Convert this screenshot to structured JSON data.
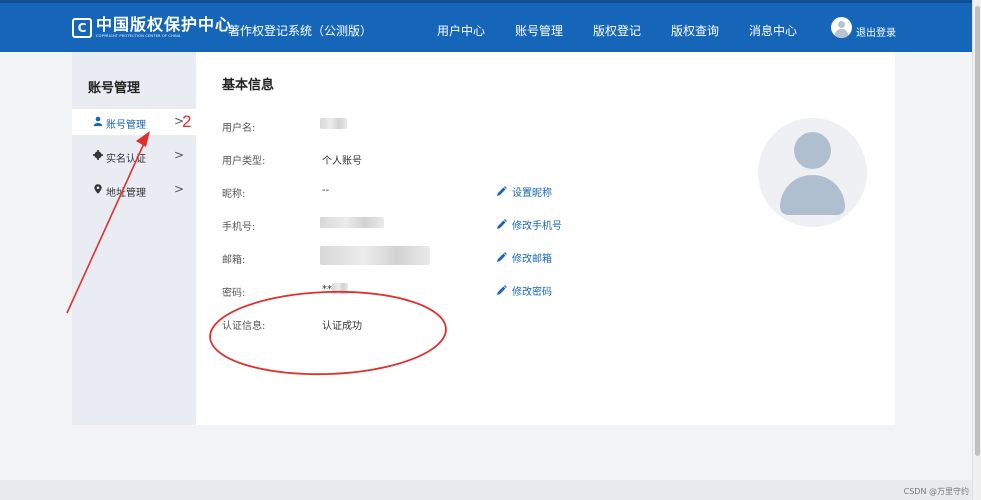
{
  "header": {
    "logo_mark": "C",
    "logo_cn": "中国版权保护中心",
    "logo_en": "COPYRIGHT PROTECTION CENTER OF CHINA",
    "system_title": "著作权登记系统（公测版）",
    "nav": [
      "用户中心",
      "账号管理",
      "版权登记",
      "版权查询",
      "消息中心"
    ],
    "logout": "退出登录"
  },
  "sidebar": {
    "title": "账号管理",
    "items": [
      {
        "label": "账号管理",
        "icon": "user-icon",
        "active": true
      },
      {
        "label": "实名认证",
        "icon": "gear-icon",
        "active": false
      },
      {
        "label": "地址管理",
        "icon": "location-pin-icon",
        "active": false
      }
    ]
  },
  "main": {
    "title": "基本信息",
    "rows": [
      {
        "label": "用户名:",
        "value": ""
      },
      {
        "label": "用户类型:",
        "value": "个人账号"
      },
      {
        "label": "昵称:",
        "value": "--",
        "action": "设置昵称"
      },
      {
        "label": "手机号:",
        "value": "",
        "action": "修改手机号"
      },
      {
        "label": "邮箱:",
        "value": "",
        "action": "修改邮箱"
      },
      {
        "label": "密码:",
        "value": "**",
        "action": "修改密码"
      },
      {
        "label": "认证信息:",
        "value": "认证成功"
      }
    ]
  },
  "annotation": {
    "step_number": "2",
    "color": "#e0302e"
  },
  "footer": {
    "watermark": "CSDN @万里守约"
  },
  "colors": {
    "header_bg": "#1566b8",
    "accent": "#1566b8",
    "sidebar_bg": "#e9ecf3"
  }
}
